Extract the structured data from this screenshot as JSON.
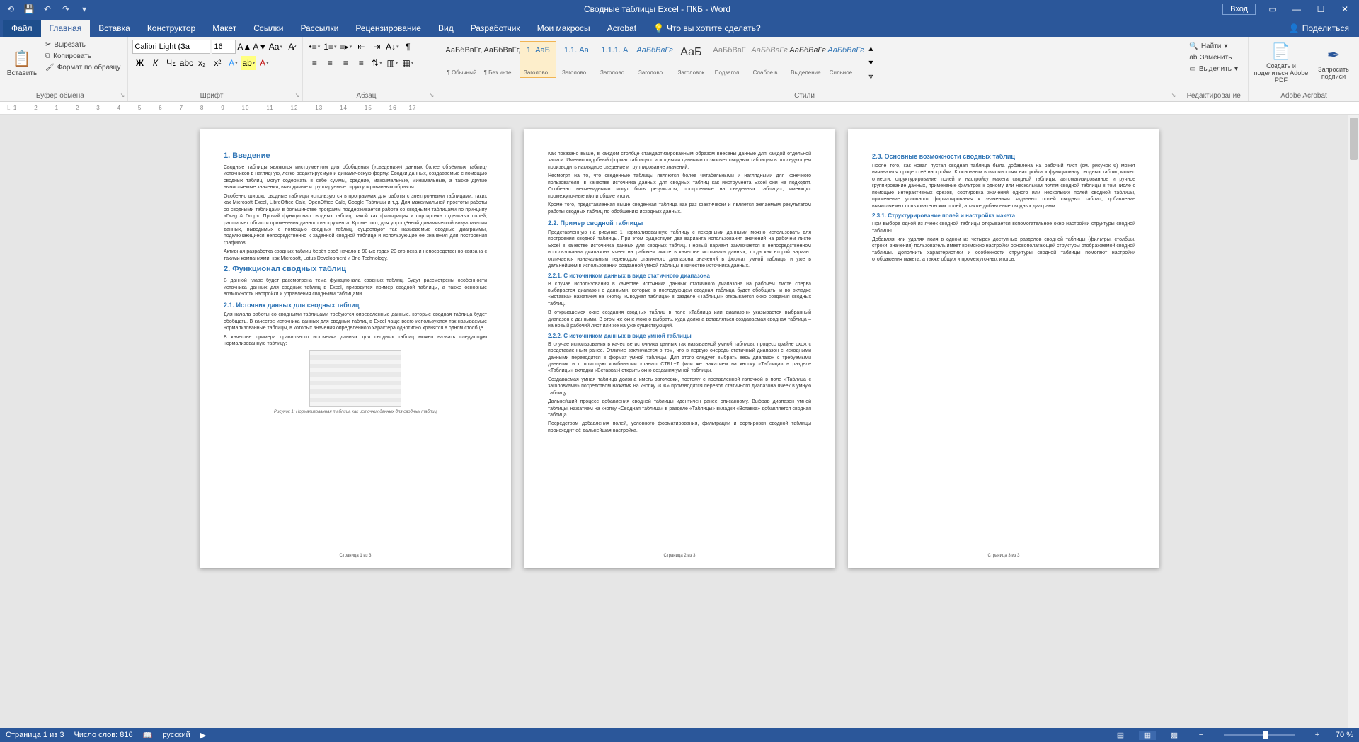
{
  "titlebar": {
    "title": "Сводные таблицы Excel - ПКБ  -  Word",
    "login": "Вход"
  },
  "tabs": {
    "file": "Файл",
    "items": [
      "Главная",
      "Вставка",
      "Конструктор",
      "Макет",
      "Ссылки",
      "Рассылки",
      "Рецензирование",
      "Вид",
      "Разработчик",
      "Мои макросы",
      "Acrobat"
    ],
    "active_index": 0,
    "tell_me": "Что вы хотите сделать?",
    "share": "Поделиться"
  },
  "ribbon": {
    "clipboard": {
      "paste": "Вставить",
      "cut": "Вырезать",
      "copy": "Копировать",
      "format_painter": "Формат по образцу",
      "label": "Буфер обмена"
    },
    "font": {
      "name": "Calibri Light (За",
      "size": "16",
      "label": "Шрифт"
    },
    "paragraph": {
      "label": "Абзац"
    },
    "styles": {
      "label": "Стили",
      "items": [
        {
          "preview": "АаБбВвГг,",
          "name": "¶ Обычный"
        },
        {
          "preview": "АаБбВвГг,",
          "name": "¶ Без инте..."
        },
        {
          "preview": "1. АаБ",
          "name": "Заголово..."
        },
        {
          "preview": "1.1. Аа",
          "name": "Заголово..."
        },
        {
          "preview": "1.1.1. А",
          "name": "Заголово..."
        },
        {
          "preview": "АаБбВвГг",
          "name": "Заголово..."
        },
        {
          "preview": "АаБ",
          "name": "Заголовок"
        },
        {
          "preview": "АаБбВвГ",
          "name": "Подзагол..."
        },
        {
          "preview": "АаБбВвГг",
          "name": "Слабое в..."
        },
        {
          "preview": "АаБбВвГг",
          "name": "Выделение"
        },
        {
          "preview": "АаБбВвГг",
          "name": "Сильное ..."
        }
      ],
      "selected_index": 2
    },
    "editing": {
      "find": "Найти",
      "replace": "Заменить",
      "select": "Выделить",
      "label": "Редактирование"
    },
    "acrobat": {
      "create_share": "Создать и поделиться Adobe PDF",
      "request_sign": "Запросить подписи",
      "label": "Adobe Acrobat"
    }
  },
  "ruler": "1 · · · 2 · · · 1 · · · 2 · · · 3 · · · 4 · · · 5 · · · 6 · · · 7 · · · 8 · · · 9 · · · 10 · · · 11 · · · 12 · · · 13 · · · 14 · · · 15 · · · 16 · · 17 ·",
  "pages": {
    "p1": {
      "h1": "1. Введение",
      "para1": "Сводные таблицы являются инструментом для обобщения («сведения») данных более объёмных таблиц-источников в наглядную, легко редактируемую и динамическую форму. Сводки данных, создаваемые с помощью сводных таблиц, могут содержать в себе суммы, средние, максимальные, минимальные, а также другие вычисляемые значения, выводимые и группируемые структурированным образом.",
      "para2": "Особенно широко сводные таблицы используются в программах для работы с электронными таблицами, таких как Microsoft Excel, LibreOffice Calc, OpenOffice Calc, Google Таблицы и т.д. Для максимальной простоты работы со сводными таблицами в большинстве программ поддерживается работа со сводными таблицами по принципу «Drag & Drop». Прочий функционал сводных таблиц, такой как фильтрация и сортировка отдельных полей, расширяет области применения данного инструмента. Кроме того, для упрощённой динамической визуализации данных, выводимых с помощью сводных таблиц, существуют так называемые сводные диаграммы, подключающиеся непосредственно к заданной сводной таблице и использующие её значения для построения графиков.",
      "para3": "Активная разработка сводных таблиц берёт своё начало в 90-ых годах 20-ого века и непосредственно связана с такими компаниями, как Microsoft, Lotus Development и Brio Technology.",
      "h2a": "2. Функционал сводных таблиц",
      "para4": "В данной главе будет рассмотрена тема функционала сводных таблиц. Будут рассмотрены особенности источника данных для сводных таблиц в Excel, приводится пример сводной таблицы, а также основные возможности настройки и управления сводными таблицами.",
      "h3a": "2.1. Источник данных для сводных таблиц",
      "para5": "Для начала работы со сводными таблицами требуются определенные данные, которые сводная таблица будет обобщать. В качестве источника данных для сводных таблиц в Excel чаще всего используются так называемые нормализованные таблицы, в которых значения определённого характера однотипно хранятся в одном столбце.",
      "para6": "В качестве примера правильного источника данных для сводных таблиц можно назвать следующую нормализованную таблицу:",
      "caption": "Рисунок 1: Нормализованная таблица как источник данных для сводных таблиц",
      "footer": "Страница 1 из 3"
    },
    "p2": {
      "para1": "Как показано выше, в каждом столбце стандартизированным образом внесены данные для каждой отдельной записи. Именно подобный формат таблицы с исходными данными позволяет сводным таблицам в последующем производить наглядное сведение и группирование значений.",
      "para2": "Несмотря на то, что сведенные таблицы являются более читабельными и наглядными для конечного пользователя, в качестве источника данных для сводных таблиц как инструмента Excel они не подходят. Особенно неочевидными могут быть результаты, построенные на сведенных таблицах, имеющих промежуточные и/или общие итоги.",
      "para3": "Кроме того, представленная выше сведенная таблица как раз фактически и является желаемым результатом работы сводных таблиц по обобщению исходных данных.",
      "h3a": "2.2. Пример сводной таблицы",
      "para4": "Представленную на рисунке 1 нормализованную таблицу с исходными данными можно использовать для построения сводной таблицы. При этом существует два варианта использования значений на рабочем листе Excel в качестве источника данных для сводных таблиц. Первый вариант заключается в непосредственном использовании диапазона ячеек на рабочем листе в качестве источника данных, тогда как второй вариант отличается изначальным переводом статичного диапазона значений в формат умной таблицы и уже в дальнейшем в использовании созданной умной таблицы в качестве источника данных.",
      "h3b": "2.2.1. С источником данных в виде статичного диапазона",
      "para5": "В случае использования в качестве источника данных статичного диапазона на рабочем листе сперва выбирается диапазон с данными, которые в последующем сводная таблица будет обобщать, и во вкладке «Вставка» нажатием на кнопку «Сводная таблица» в разделе «Таблицы» открывается окно создания сводных таблиц.",
      "para6": "В открывшемся окне создания сводных таблиц в поле «Таблица или диапазон» указывается выбранный диапазон с данными. В этом же окне можно выбрать, куда должна вставляться создаваемая сводная таблица – на новый рабочий лист или же на уже существующий.",
      "h3c": "2.2.2. С источником данных в виде умной таблицы",
      "para7": "В случае использования в качестве источника данных так называемой умной таблицы, процесс крайне схож с представленным ранее. Отличие заключается в том, что в первую очередь статичный диапазон с исходными данными переводится в формат умной таблицы. Для этого следует выбрать весь диапазон с требуемыми данными и с помощью комбинации клавиш CTRL+T (или же нажатием на кнопку «Таблица» в разделе «Таблицы» вкладки «Вставка») открыть окно создания умной таблицы.",
      "para8": "Создаваемая умная таблица должна иметь заголовки, поэтому с поставленной галочкой в поле «Таблица с заголовками» посредством нажатия на кнопку «ОК» производится перевод статичного диапазона ячеек в умную таблицу.",
      "para9": "Дальнейший процесс добавления сводной таблицы идентичен ранее описанному. Выбрав диапазон умной таблицы, нажатием на кнопку «Сводная таблица» в разделе «Таблицы» вкладки «Вставка» добавляется сводная таблица.",
      "para10": "Посредством добавления полей, условного форматирования, фильтрации и сортировки сводной таблицы происходит её дальнейшая настройка.",
      "footer": "Страница 2 из 3"
    },
    "p3": {
      "h3a": "2.3. Основные возможности сводных таблиц",
      "para1": "После того, как новая пустая сводная таблица была добавлена на рабочий лист (см. рисунок 6) может начинаться процесс её настройки. К основным возможностям настройки и функционалу сводных таблиц можно отнести: структурирование полей и настройку макета сводной таблицы, автоматизированное и ручное группирование данных, применение фильтров к одному или нескольким полям сводной таблицы в том числе с помощью интерактивных срезов, сортировка значений одного или нескольких полей сводной таблицы, применение условного форматирования к значениям заданных полей сводных таблиц, добавление вычисляемых пользовательских полей, а также добавление сводных диаграмм.",
      "h3b": "2.3.1. Структурирование полей и настройка макета",
      "para2": "При выборе одной из ячеек сводной таблицы открывается вспомогательное окно настройки структуры сводной таблицы.",
      "para3": "Добавляя или удаляя поля в одном из четырех доступных разделов сводной таблицы (фильтры, столбцы, строки, значения) пользователь имеет возможно настройки основополагающей структуры отображаемой сводной таблицы. Дополнить характеристики и особенности структуры сводной таблицы помогают настройки отображения макета, а также общих и промежуточных итогов.",
      "footer": "Страница 3 из 3"
    }
  },
  "statusbar": {
    "page": "Страница 1 из 3",
    "words": "Число слов: 816",
    "lang": "русский",
    "zoom": "70 %"
  }
}
